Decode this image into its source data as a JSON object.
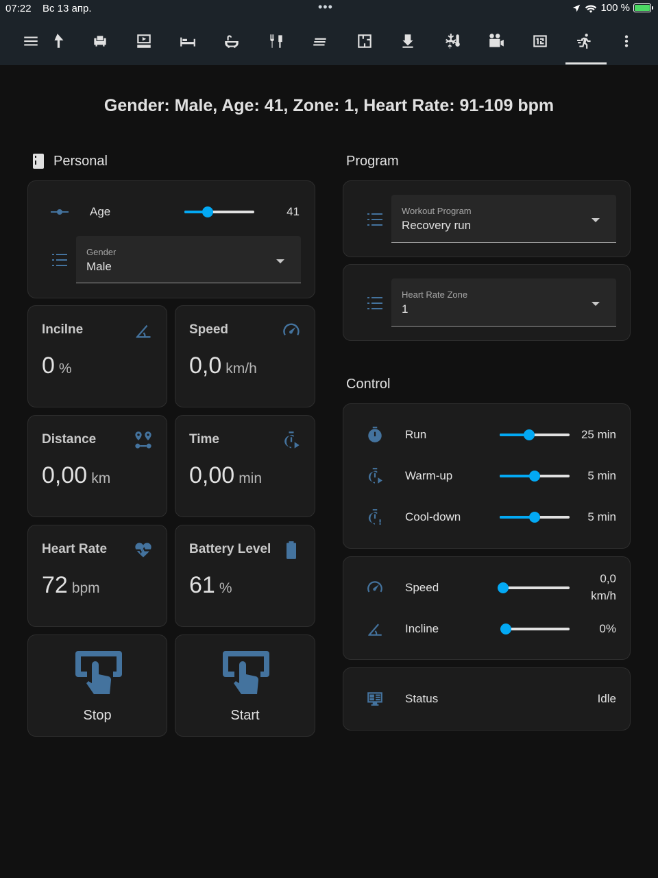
{
  "status_bar": {
    "time": "07:22",
    "date": "Вс 13 апр.",
    "dots": "•••",
    "battery_text": "100 %"
  },
  "toolbar": {
    "icons": [
      "menu-icon",
      "cursor-icon",
      "sofa-icon",
      "home-theater-icon",
      "bed-icon",
      "bathtub-icon",
      "kitchen-icon",
      "hallway-icon",
      "floor-plan-icon",
      "stairs-icon",
      "climate-icon",
      "camera-icon",
      "counter-icon",
      "treadmill-icon",
      "more-icon"
    ],
    "active": "treadmill-icon"
  },
  "summary": "Gender: Male, Age: 41, Zone: 1, Heart Rate: 91-109 bpm",
  "personal": {
    "title": "Personal",
    "age": {
      "label": "Age",
      "value": "41",
      "level": 0.3
    },
    "gender": {
      "label": "Gender",
      "value": "Male"
    }
  },
  "tiles": [
    {
      "name": "Incilne",
      "value": "0",
      "unit": "%",
      "icon": "incline-icon"
    },
    {
      "name": "Speed",
      "value": "0,0",
      "unit": "km/h",
      "icon": "speedometer-icon"
    },
    {
      "name": "Distance",
      "value": "0,00",
      "unit": "km",
      "icon": "map-marker-distance-icon"
    },
    {
      "name": "Time",
      "value": "0,00",
      "unit": "min",
      "icon": "timer-play-icon"
    },
    {
      "name": "Heart Rate",
      "value": "72",
      "unit": "bpm",
      "icon": "heart-pulse-icon"
    },
    {
      "name": "Battery Level",
      "value": "61",
      "unit": "%",
      "icon": "battery-icon"
    }
  ],
  "buttons": {
    "stop": "Stop",
    "start": "Start"
  },
  "program": {
    "title": "Program",
    "workout": {
      "label": "Workout Program",
      "value": "Recovery run"
    },
    "zone": {
      "label": "Heart Rate Zone",
      "value": "1"
    }
  },
  "control": {
    "title": "Control",
    "timers": [
      {
        "label": "Run",
        "value": "25 min",
        "level": 0.41
      },
      {
        "label": "Warm-up",
        "value": "5 min",
        "level": 0.5
      },
      {
        "label": "Cool-down",
        "value": "5 min",
        "level": 0.5
      }
    ],
    "speed": {
      "label": "Speed",
      "value_line1": "0,0",
      "value_line2": "km/h",
      "level": 0.0
    },
    "incline": {
      "label": "Incline",
      "value": "0%",
      "level": 0.0
    },
    "status": {
      "label": "Status",
      "value": "Idle"
    }
  },
  "colors": {
    "background": "#111111",
    "card": "#1c1c1c",
    "icon": "#44739e",
    "slider": "#03a9f4",
    "toolbar": "#1c2329"
  }
}
